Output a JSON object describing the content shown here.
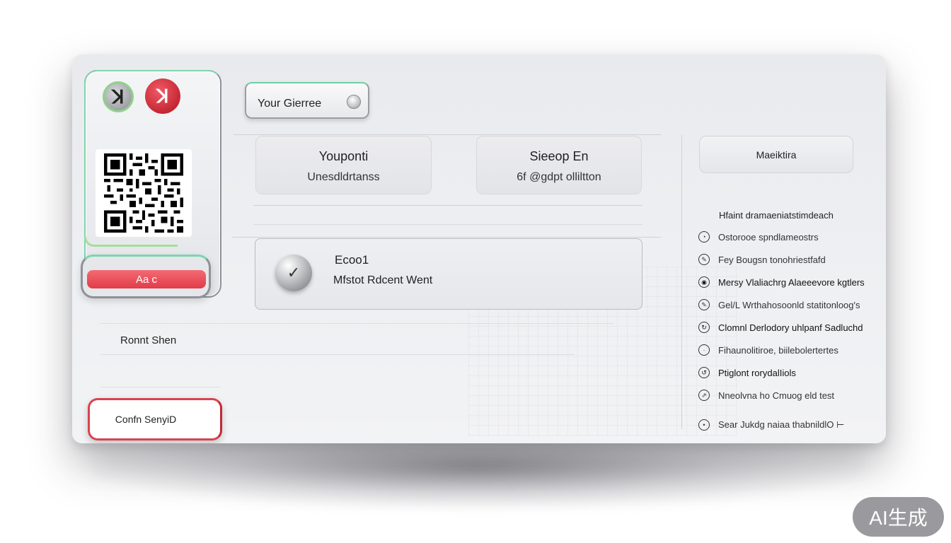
{
  "header": {
    "search_label": "Your Gierree"
  },
  "left_panel": {
    "logo_a_glyph": "ꓘ",
    "logo_b_glyph": "ꓘ",
    "action_button": "Aa c"
  },
  "tiles": [
    {
      "title": "Youponti",
      "subtitle": "Unesdldrtanss"
    },
    {
      "title": "Sieeop En",
      "subtitle": "6f @gdpt olliltton"
    }
  ],
  "wide_card": {
    "title": "Ecoo1",
    "subtitle": "Mfstot Rdcent  Went"
  },
  "section_label": "Ronnt Shen",
  "confirm_button": "Confn SenyiD",
  "right": {
    "button": "Maeiktira",
    "list_heading": "Hfaint dramaeniatstimdeach",
    "items": [
      "Ostorooe spndlameostrs",
      "Fey Bougsn tonohriestfafd",
      "Mersy Vlaliachrg Alaeeevore kgtlers",
      "Gel/L Wrthahosoonld statitonloog's",
      "Clomnl Derlodory uhlpanf Sadluchd",
      "Fihaunolitiroe, biilebolertertes",
      "Ptiglont rorydalIiols",
      "Nneolvna ho Cmuog eld test",
      "Sear Jukdg naiaa thabnildlO   ⊢"
    ]
  },
  "watermark": "AI生成"
}
